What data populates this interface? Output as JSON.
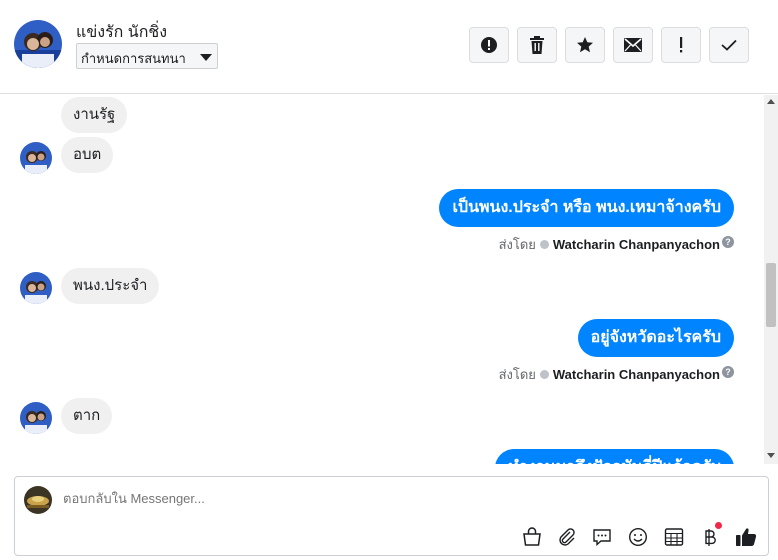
{
  "header": {
    "contact_name": "แข่งรัก นักชิ่ง",
    "conversation_select": "กำหนดการสนทนา",
    "toolbar": [
      {
        "icon": "alert-circle-icon",
        "action": "report"
      },
      {
        "icon": "trash-icon",
        "action": "delete"
      },
      {
        "icon": "star-icon",
        "action": "star"
      },
      {
        "icon": "envelope-icon",
        "action": "mark-unread"
      },
      {
        "icon": "exclamation-icon",
        "action": "spam"
      },
      {
        "icon": "check-icon",
        "action": "done"
      }
    ]
  },
  "messages": [
    {
      "direction": "in",
      "text": "งานรัฐ",
      "avatar": false
    },
    {
      "direction": "in",
      "text": "อบต",
      "avatar": true
    },
    {
      "direction": "out",
      "text": "เป็นพนง.ประจำ หรือ พนง.เหมาจ้างครับ",
      "sent_by_label": "ส่งโดย",
      "sender": "Watcharin Chanpanyachon"
    },
    {
      "direction": "in",
      "text": "พนง.ประจำ",
      "avatar": true
    },
    {
      "direction": "out",
      "text": "อยู่จังหวัดอะไรครับ",
      "sent_by_label": "ส่งโดย",
      "sender": "Watcharin Chanpanyachon"
    },
    {
      "direction": "in",
      "text": "ตาก",
      "avatar": true
    },
    {
      "direction": "out",
      "text": "ทำงานมาถึงปัจจุบันกี่ปีแล้วครับ",
      "partial": true
    }
  ],
  "composer": {
    "placeholder": "ตอบกลับใน Messenger..."
  },
  "colors": {
    "outgoing_bubble": "#0084ff",
    "incoming_bubble": "#f0f0f0",
    "notification": "#f02849"
  }
}
